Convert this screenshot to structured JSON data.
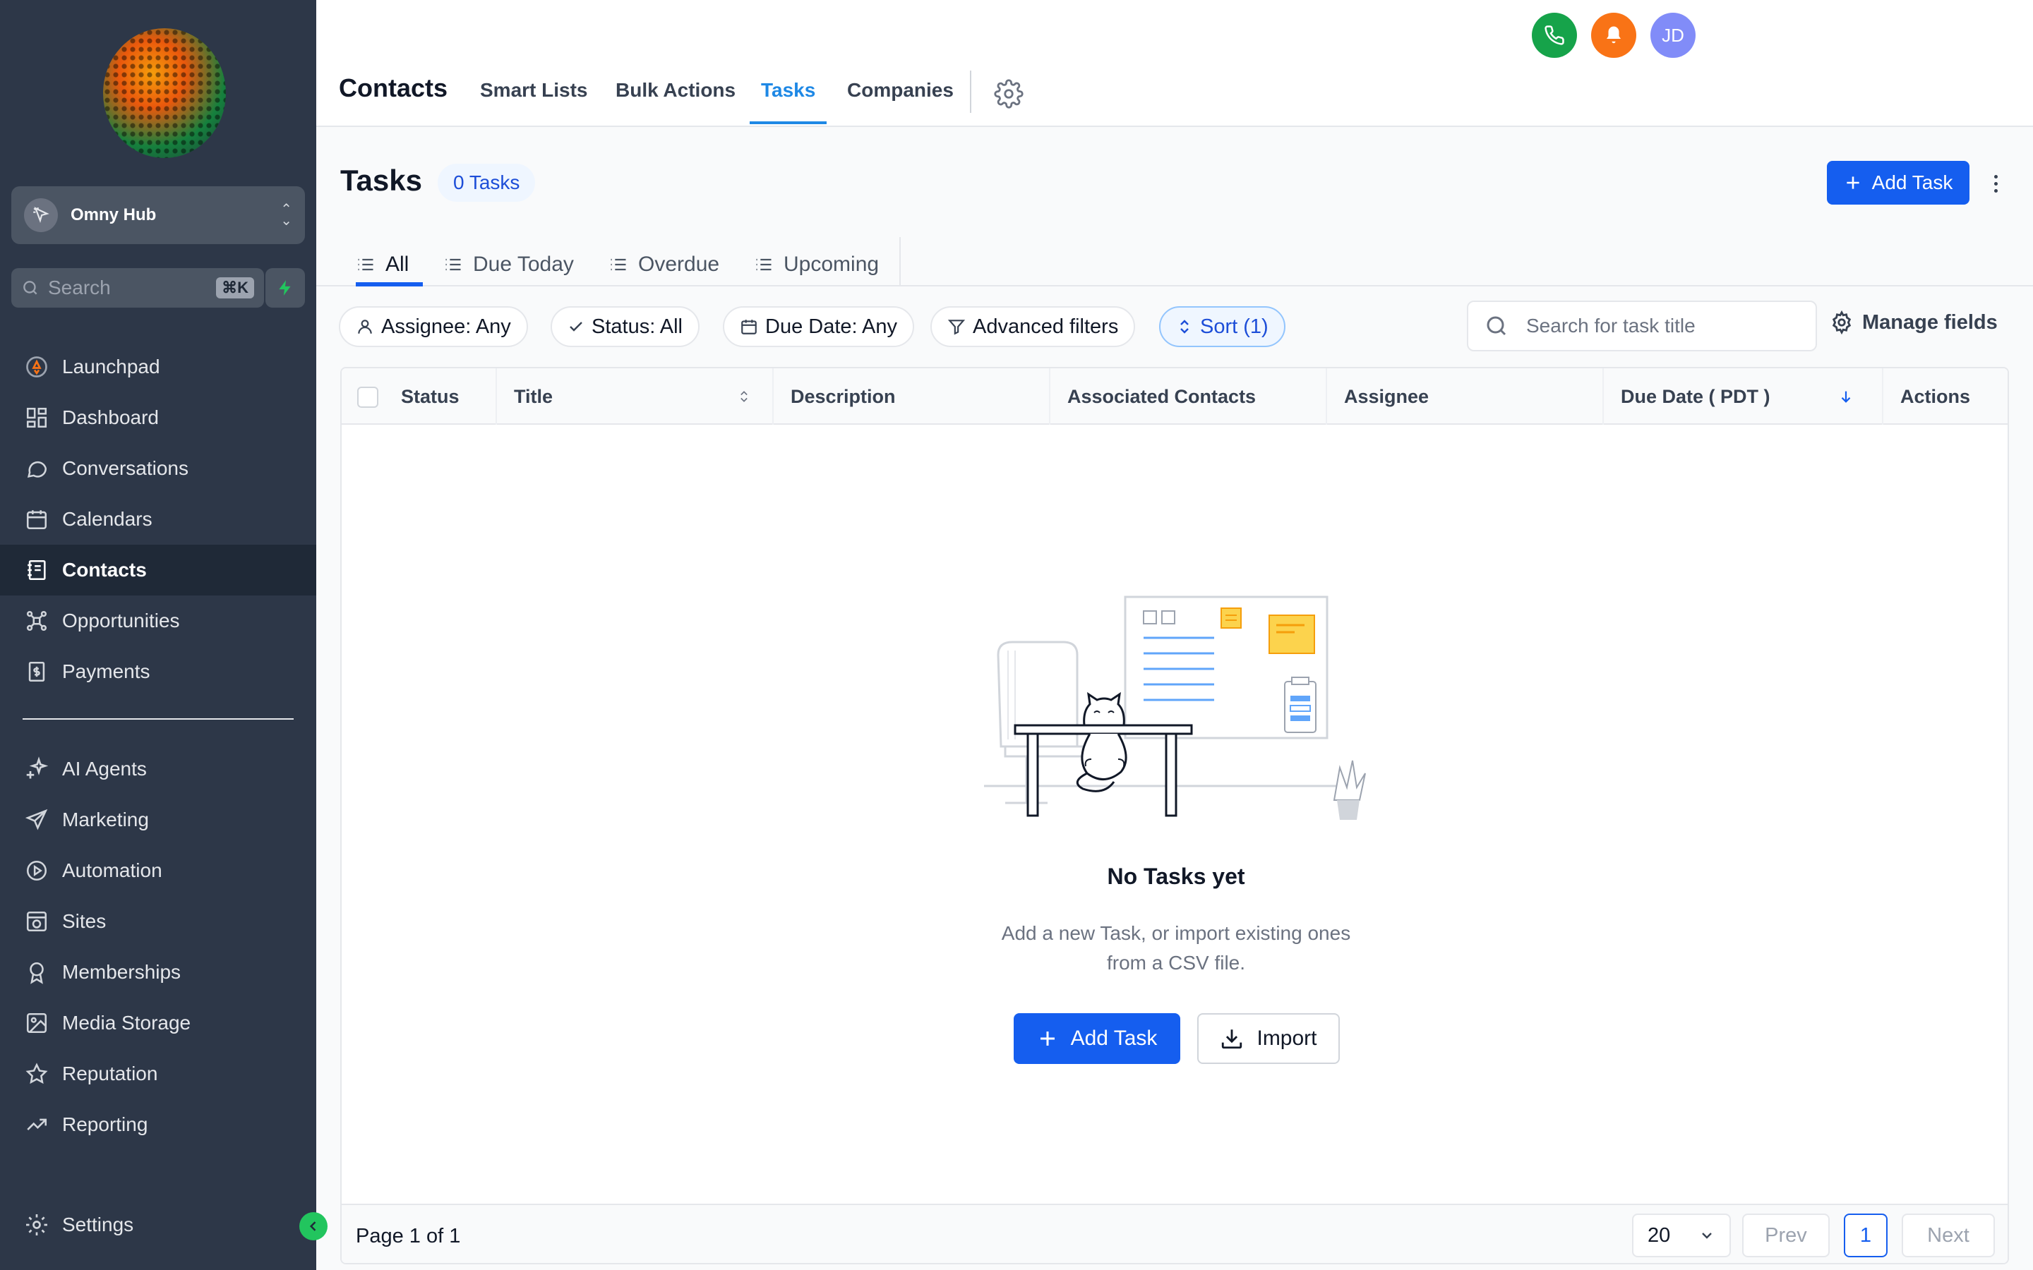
{
  "app": {
    "account_name": "Omny Hub",
    "search_placeholder": "Search",
    "search_shortcut": "⌘K",
    "user_initials": "JD"
  },
  "sidebar": {
    "items": [
      {
        "label": "Launchpad",
        "icon": "rocket-icon"
      },
      {
        "label": "Dashboard",
        "icon": "grid-icon"
      },
      {
        "label": "Conversations",
        "icon": "chat-icon"
      },
      {
        "label": "Calendars",
        "icon": "calendar-icon"
      },
      {
        "label": "Contacts",
        "icon": "contacts-icon",
        "active": true
      },
      {
        "label": "Opportunities",
        "icon": "opportunities-icon"
      },
      {
        "label": "Payments",
        "icon": "payments-icon"
      }
    ],
    "items2": [
      {
        "label": "AI Agents",
        "icon": "sparkle-icon"
      },
      {
        "label": "Marketing",
        "icon": "send-icon"
      },
      {
        "label": "Automation",
        "icon": "automation-icon"
      },
      {
        "label": "Sites",
        "icon": "sites-icon"
      },
      {
        "label": "Memberships",
        "icon": "badge-icon"
      },
      {
        "label": "Media Storage",
        "icon": "image-icon"
      },
      {
        "label": "Reputation",
        "icon": "star-icon"
      },
      {
        "label": "Reporting",
        "icon": "trend-icon"
      }
    ],
    "settings_label": "Settings"
  },
  "header": {
    "section_title": "Contacts",
    "tabs": [
      "Smart Lists",
      "Bulk Actions",
      "Tasks",
      "Companies"
    ],
    "active_tab": "Tasks"
  },
  "page": {
    "title": "Tasks",
    "count_badge": "0 Tasks",
    "add_task_label": "Add Task",
    "subtabs": [
      "All",
      "Due Today",
      "Overdue",
      "Upcoming"
    ],
    "active_subtab": "All"
  },
  "filters": {
    "assignee": "Assignee: Any",
    "status": "Status: All",
    "due_date": "Due Date: Any",
    "advanced": "Advanced filters",
    "sort": "Sort (1)",
    "search_placeholder": "Search for task title",
    "manage_fields": "Manage fields"
  },
  "table": {
    "columns": [
      "Status",
      "Title",
      "Description",
      "Associated Contacts",
      "Assignee",
      "Due Date ( PDT )",
      "Actions"
    ],
    "rows": []
  },
  "empty_state": {
    "title": "No Tasks yet",
    "description": "Add a new Task, or import existing ones from a CSV file.",
    "add_label": "Add Task",
    "import_label": "Import"
  },
  "pagination": {
    "info": "Page 1 of 1",
    "per_page": "20",
    "prev": "Prev",
    "current": "1",
    "next": "Next"
  },
  "colors": {
    "primary": "#155eef",
    "sidebar_bg": "#2d3748",
    "active_tab": "#1e88e5",
    "phone": "#16a34a",
    "bell": "#f97316",
    "avatar": "#818cf8"
  }
}
